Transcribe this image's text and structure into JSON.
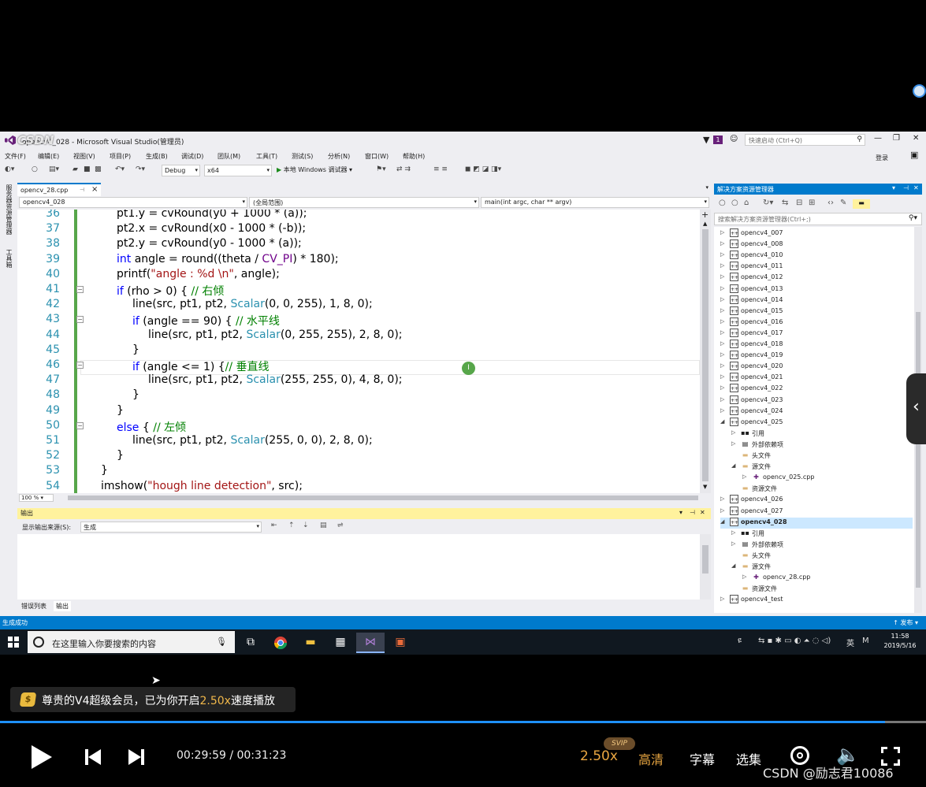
{
  "vs": {
    "watermark": "CSDN",
    "title": "opencv4_028 - Microsoft Visual Studio(管理员)",
    "notif_count": "1",
    "quick_launch_placeholder": "快速启动 (Ctrl+Q)",
    "login": "登录",
    "menu": [
      "文件(F)",
      "编辑(E)",
      "视图(V)",
      "项目(P)",
      "生成(B)",
      "调试(D)",
      "团队(M)",
      "工具(T)",
      "测试(S)",
      "分析(N)",
      "窗口(W)",
      "帮助(H)"
    ],
    "toolbar": {
      "config": "Debug",
      "platform": "x64",
      "run_label": "本地 Windows 调试器"
    },
    "left_strip": [
      "服务器资源管理器",
      "工具箱"
    ],
    "doc_tab": "opencv_28.cpp",
    "ghost_text": "qq_38088887",
    "nav": {
      "project": "opencv4_028",
      "scope": "(全局范围)",
      "member": "main(int argc, char ** argv)"
    },
    "code_lines": [
      {
        "n": "36",
        "html": "        pt1.y = cvRound(y0 + 1000 * (a));"
      },
      {
        "n": "37",
        "html": "        pt2.x = cvRound(x0 - 1000 * (-b));"
      },
      {
        "n": "38",
        "html": "        pt2.y = cvRound(y0 - 1000 * (a));"
      },
      {
        "n": "39",
        "html": "        <span class=\"kw\">int</span> angle = round((theta / <span class=\"mac\">CV_PI</span>) * 180);"
      },
      {
        "n": "40",
        "html": "        printf(<span class=\"str\">\"angle : %d \\n\"</span>, angle);"
      },
      {
        "n": "41",
        "html": "        <span class=\"kw\">if</span> (rho > 0) { <span class=\"cm\">// 右倾</span>",
        "fold": true
      },
      {
        "n": "42",
        "html": "            line(src, pt1, pt2, <span class=\"ty\">Scalar</span>(0, 0, 255), 1, 8, 0);"
      },
      {
        "n": "43",
        "html": "            <span class=\"kw\">if</span> (angle == 90) { <span class=\"cm\">// 水平线</span>",
        "fold": true
      },
      {
        "n": "44",
        "html": "                line(src, pt1, pt2, <span class=\"ty\">Scalar</span>(0, 255, 255), 2, 8, 0);"
      },
      {
        "n": "45",
        "html": "            }"
      },
      {
        "n": "46",
        "html": "            <span class=\"kw\">if</span> (angle <= 1) {<span class=\"cm\">// 垂直线</span>",
        "fold": true
      },
      {
        "n": "47",
        "html": "                line(src, pt1, pt2, <span class=\"ty\">Scalar</span>(255, 255, 0), 4, 8, 0);"
      },
      {
        "n": "48",
        "html": "            }"
      },
      {
        "n": "49",
        "html": "        }"
      },
      {
        "n": "50",
        "html": "        <span class=\"kw\">else</span> { <span class=\"cm\">// 左倾</span>",
        "fold": true
      },
      {
        "n": "51",
        "html": "            line(src, pt1, pt2, <span class=\"ty\">Scalar</span>(255, 0, 0), 2, 8, 0);"
      },
      {
        "n": "52",
        "html": "        }"
      },
      {
        "n": "53",
        "html": "    }"
      },
      {
        "n": "54",
        "html": "    imshow(<span class=\"str\">\"hough line detection\"</span>, src);"
      }
    ],
    "zoom": "100 %",
    "output": {
      "title": "输出",
      "source_label": "显示输出来源(S):",
      "source_value": "生成",
      "tabs": [
        "错误列表",
        "输出"
      ]
    },
    "solution_explorer": {
      "title": "解决方案资源管理器",
      "search_placeholder": "搜索解决方案资源管理器(Ctrl+;)",
      "nodes": [
        {
          "label": "opencv4_007",
          "level": 0,
          "tw": "▷",
          "icon": "proj"
        },
        {
          "label": "opencv4_008",
          "level": 0,
          "tw": "▷",
          "icon": "proj"
        },
        {
          "label": "opencv4_010",
          "level": 0,
          "tw": "▷",
          "icon": "proj"
        },
        {
          "label": "opencv4_011",
          "level": 0,
          "tw": "▷",
          "icon": "proj"
        },
        {
          "label": "opencv4_012",
          "level": 0,
          "tw": "▷",
          "icon": "proj"
        },
        {
          "label": "opencv4_013",
          "level": 0,
          "tw": "▷",
          "icon": "proj"
        },
        {
          "label": "opencv4_014",
          "level": 0,
          "tw": "▷",
          "icon": "proj"
        },
        {
          "label": "opencv4_015",
          "level": 0,
          "tw": "▷",
          "icon": "proj"
        },
        {
          "label": "opencv4_016",
          "level": 0,
          "tw": "▷",
          "icon": "proj"
        },
        {
          "label": "opencv4_017",
          "level": 0,
          "tw": "▷",
          "icon": "proj"
        },
        {
          "label": "opencv4_018",
          "level": 0,
          "tw": "▷",
          "icon": "proj"
        },
        {
          "label": "opencv4_019",
          "level": 0,
          "tw": "▷",
          "icon": "proj"
        },
        {
          "label": "opencv4_020",
          "level": 0,
          "tw": "▷",
          "icon": "proj"
        },
        {
          "label": "opencv4_021",
          "level": 0,
          "tw": "▷",
          "icon": "proj"
        },
        {
          "label": "opencv4_022",
          "level": 0,
          "tw": "▷",
          "icon": "proj"
        },
        {
          "label": "opencv4_023",
          "level": 0,
          "tw": "▷",
          "icon": "proj"
        },
        {
          "label": "opencv4_024",
          "level": 0,
          "tw": "▷",
          "icon": "proj"
        },
        {
          "label": "opencv4_025",
          "level": 0,
          "tw": "◢",
          "icon": "proj"
        },
        {
          "label": "引用",
          "level": 1,
          "tw": "▷",
          "icon": "ref"
        },
        {
          "label": "外部依赖项",
          "level": 1,
          "tw": "▷",
          "icon": "ext"
        },
        {
          "label": "头文件",
          "level": 1,
          "tw": "",
          "icon": "folder"
        },
        {
          "label": "源文件",
          "level": 1,
          "tw": "◢",
          "icon": "folder"
        },
        {
          "label": "opencv_025.cpp",
          "level": 2,
          "tw": "▷",
          "icon": "cpp"
        },
        {
          "label": "资源文件",
          "level": 1,
          "tw": "",
          "icon": "folder"
        },
        {
          "label": "opencv4_026",
          "level": 0,
          "tw": "▷",
          "icon": "proj"
        },
        {
          "label": "opencv4_027",
          "level": 0,
          "tw": "▷",
          "icon": "proj"
        },
        {
          "label": "opencv4_028",
          "level": 0,
          "tw": "◢",
          "icon": "proj",
          "selected": true
        },
        {
          "label": "引用",
          "level": 1,
          "tw": "▷",
          "icon": "ref"
        },
        {
          "label": "外部依赖项",
          "level": 1,
          "tw": "▷",
          "icon": "ext"
        },
        {
          "label": "头文件",
          "level": 1,
          "tw": "",
          "icon": "folder"
        },
        {
          "label": "源文件",
          "level": 1,
          "tw": "◢",
          "icon": "folder"
        },
        {
          "label": "opencv_28.cpp",
          "level": 2,
          "tw": "▷",
          "icon": "cpp"
        },
        {
          "label": "资源文件",
          "level": 1,
          "tw": "",
          "icon": "folder"
        },
        {
          "label": "opencv4_test",
          "level": 0,
          "tw": "▷",
          "icon": "proj"
        }
      ]
    },
    "status": "生成成功",
    "publish": "↑ 发布 ▾"
  },
  "taskbar": {
    "search_placeholder": "在这里输入你要搜索的内容",
    "tray_lang": "英",
    "time": "11:58",
    "date": "2019/5/16"
  },
  "player": {
    "vip_prefix": "尊贵的V4超级会员，已为你开启",
    "vip_speed": "2.50x",
    "vip_suffix": "速度播放",
    "progress_fraction": 0.956,
    "buffer_fraction": 0.955,
    "time": "00:29:59 / 00:31:23",
    "speed": "2.50x",
    "svip": "SVIP",
    "quality": "高清",
    "subtitles": "字幕",
    "episodes": "选集",
    "watermark": "CSDN @励志君10086"
  }
}
